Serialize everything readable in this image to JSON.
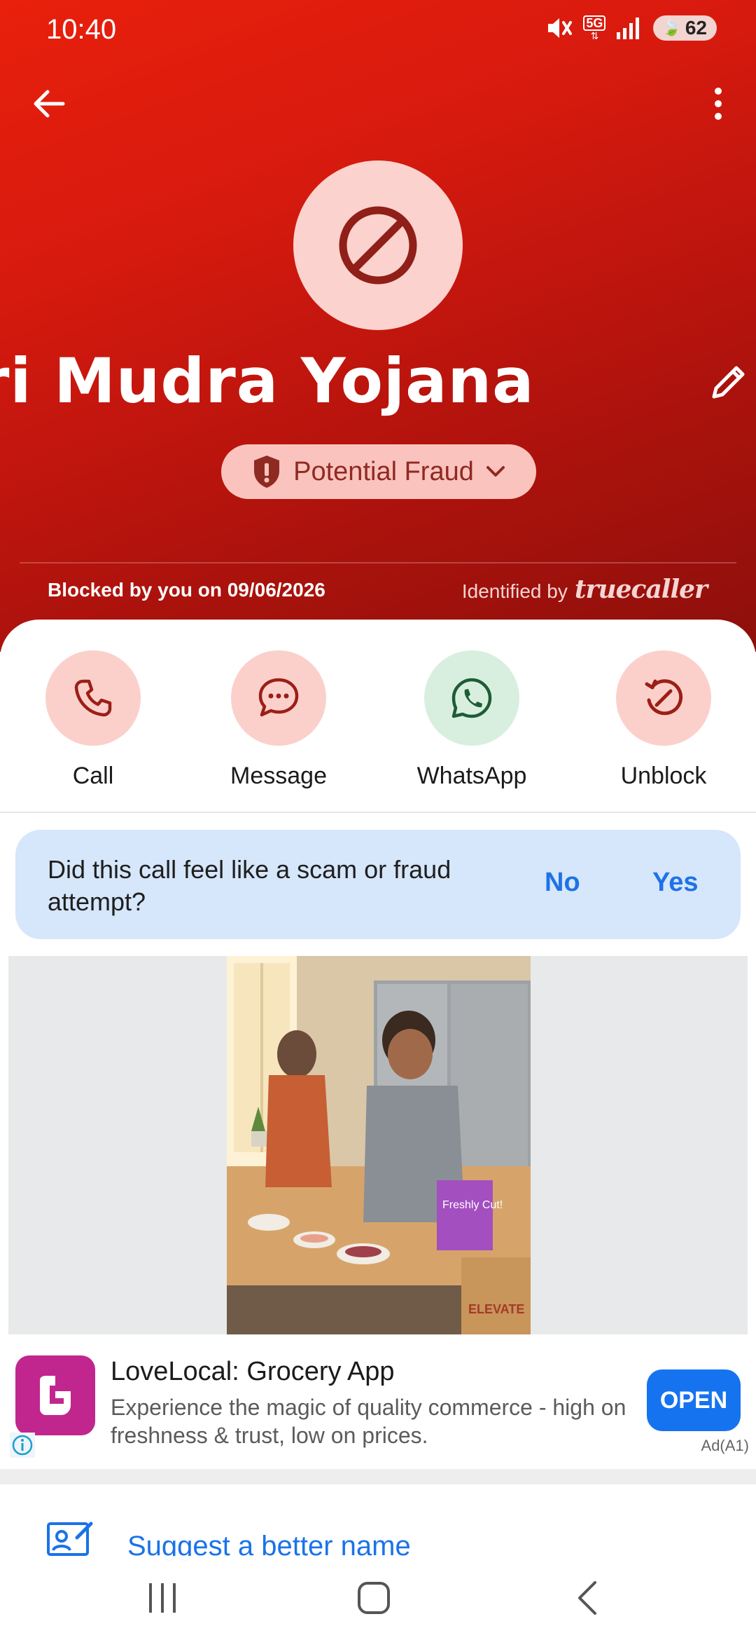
{
  "status_bar": {
    "time": "10:40",
    "network": "5G",
    "battery": "62"
  },
  "contact": {
    "name": "ri Mudra Yojana",
    "label": "Potential Fraud",
    "blocked_text": "Blocked by you on 09/06/2026",
    "identified_prefix": "Identified by",
    "identified_brand": "truecaller"
  },
  "actions": [
    {
      "label": "Call",
      "icon": "phone-icon"
    },
    {
      "label": "Message",
      "icon": "chat-icon"
    },
    {
      "label": "WhatsApp",
      "icon": "whatsapp-icon"
    },
    {
      "label": "Unblock",
      "icon": "unblock-icon"
    }
  ],
  "scam_prompt": {
    "question": "Did this call feel like a scam or fraud attempt?",
    "no": "No",
    "yes": "Yes"
  },
  "ad": {
    "title": "LoveLocal: Grocery App",
    "description": "Experience the magic of quality commerce - high on freshness & trust, low on prices.",
    "cta": "OPEN",
    "tag": "Ad(A1)",
    "photo_text_bag": "Freshly Cut!",
    "photo_text_box": "ELEVATE"
  },
  "suggest": {
    "label": "Suggest a better name"
  },
  "colors": {
    "header_red": "#d81a0e",
    "accent_blue": "#1a73e8",
    "chip_pink": "#fbc3be",
    "whatsapp_green": "#d8efe0"
  }
}
